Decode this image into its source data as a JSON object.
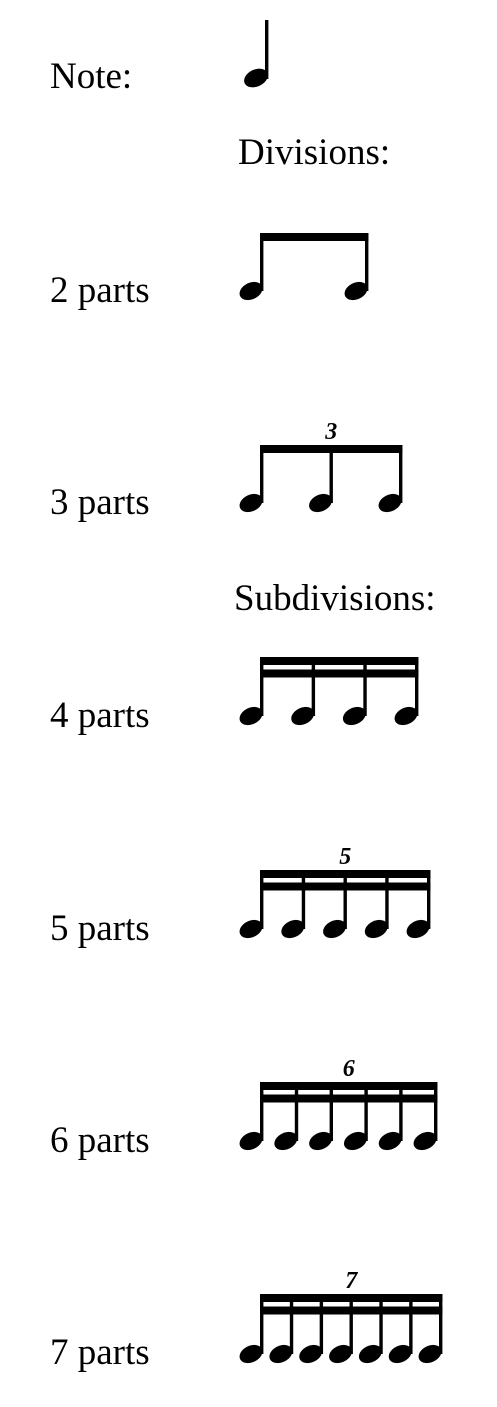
{
  "note_label": "Note:",
  "divisions_heading": "Divisions:",
  "subdivisions_heading": "Subdivisions:",
  "rows": [
    {
      "label": "2 parts",
      "notes": 2,
      "beams": 1,
      "tuplet": ""
    },
    {
      "label": "3 parts",
      "notes": 3,
      "beams": 1,
      "tuplet": "3"
    },
    {
      "label": "4 parts",
      "notes": 4,
      "beams": 2,
      "tuplet": ""
    },
    {
      "label": "5 parts",
      "notes": 5,
      "beams": 2,
      "tuplet": "5"
    },
    {
      "label": "6 parts",
      "notes": 6,
      "beams": 2,
      "tuplet": "6"
    },
    {
      "label": "7 parts",
      "notes": 7,
      "beams": 2,
      "tuplet": "7"
    }
  ]
}
